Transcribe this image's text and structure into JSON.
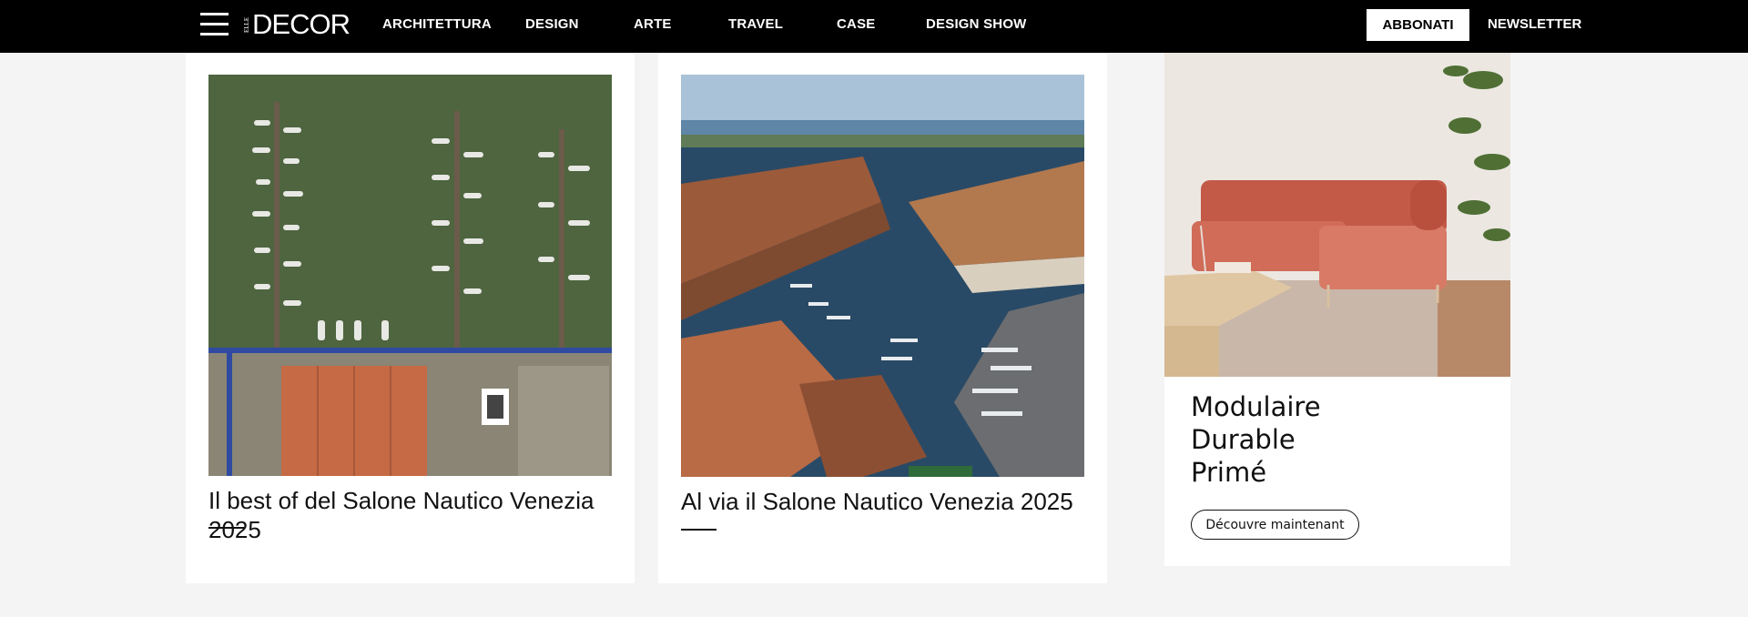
{
  "header": {
    "logo_small": "ELLE",
    "logo_big": "DECOR",
    "menu_icon": "hamburger-menu-icon",
    "nav": [
      {
        "label": "ARCHITETTURA"
      },
      {
        "label": "DESIGN"
      },
      {
        "label": "ARTE"
      },
      {
        "label": "TRAVEL"
      },
      {
        "label": "CASE"
      },
      {
        "label": "DESIGN SHOW"
      }
    ],
    "subscribe_label": "ABBONATI",
    "newsletter_label": "NEWSLETTER"
  },
  "articles": [
    {
      "title": "Il best of del Salone Nautico Venezia 2025",
      "image": "aerial-marina-photo"
    },
    {
      "title": "Al via il Salone Nautico Venezia 2025",
      "image": "aerial-venice-arsenale-photo"
    }
  ],
  "ad": {
    "image": "terracotta-modular-sofa-photo",
    "lines": [
      "Modulaire",
      "Durable",
      "Primé"
    ],
    "cta_label": "Découvre maintenant"
  },
  "colors": {
    "header_bg": "#000000",
    "page_bg": "#f4f4f4",
    "card_bg": "#ffffff",
    "text": "#111111",
    "sofa": "#c8624f"
  }
}
